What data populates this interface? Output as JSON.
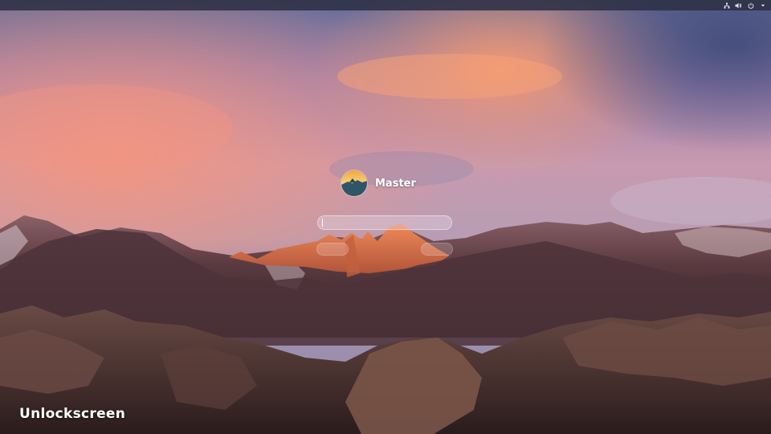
{
  "top_panel": {
    "icons": [
      "network-icon",
      "volume-icon",
      "power-icon",
      "chevron-down-icon"
    ]
  },
  "login": {
    "username": "Master",
    "password_placeholder": "",
    "left_button_label": "",
    "right_button_label": "",
    "hint": ""
  },
  "overlay": {
    "label": "Unlockscreen"
  },
  "colors": {
    "panel": "#2d3046",
    "sky_top": "#6f7aa3",
    "sky_glow": "#f29a86",
    "mountains": "#5c3f45"
  }
}
